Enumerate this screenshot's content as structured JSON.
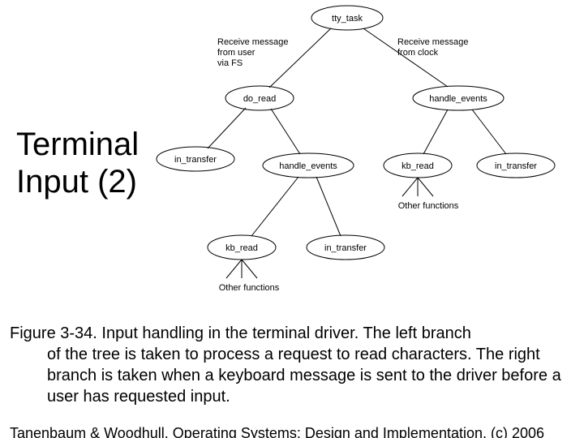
{
  "title_l1": "Terminal",
  "title_l2": "Input (2)",
  "caption_first": "Figure 3-34. Input handling in the terminal driver. The left branch",
  "caption_rest": "of the tree is taken to process a request to read characters. The right branch is taken when a keyboard message is sent to the driver before a user has requested input.",
  "credit": "Tanenbaum & Woodhull, Operating Systems: Design and Implementation, (c) 2006",
  "edge_left": "Receive message\nfrom user\nvia FS",
  "edge_right": "Receive message\nfrom clock",
  "other_left": "Other functions",
  "other_right": "Other functions",
  "nodes": {
    "tty_task": "tty_task",
    "do_read": "do_read",
    "handle_events_top": "handle_events",
    "in_transfer_L": "in_transfer",
    "handle_events_mid": "handle_events",
    "kb_read_R": "kb_read",
    "in_transfer_R": "in_transfer",
    "kb_read_B": "kb_read",
    "in_transfer_B": "in_transfer"
  }
}
